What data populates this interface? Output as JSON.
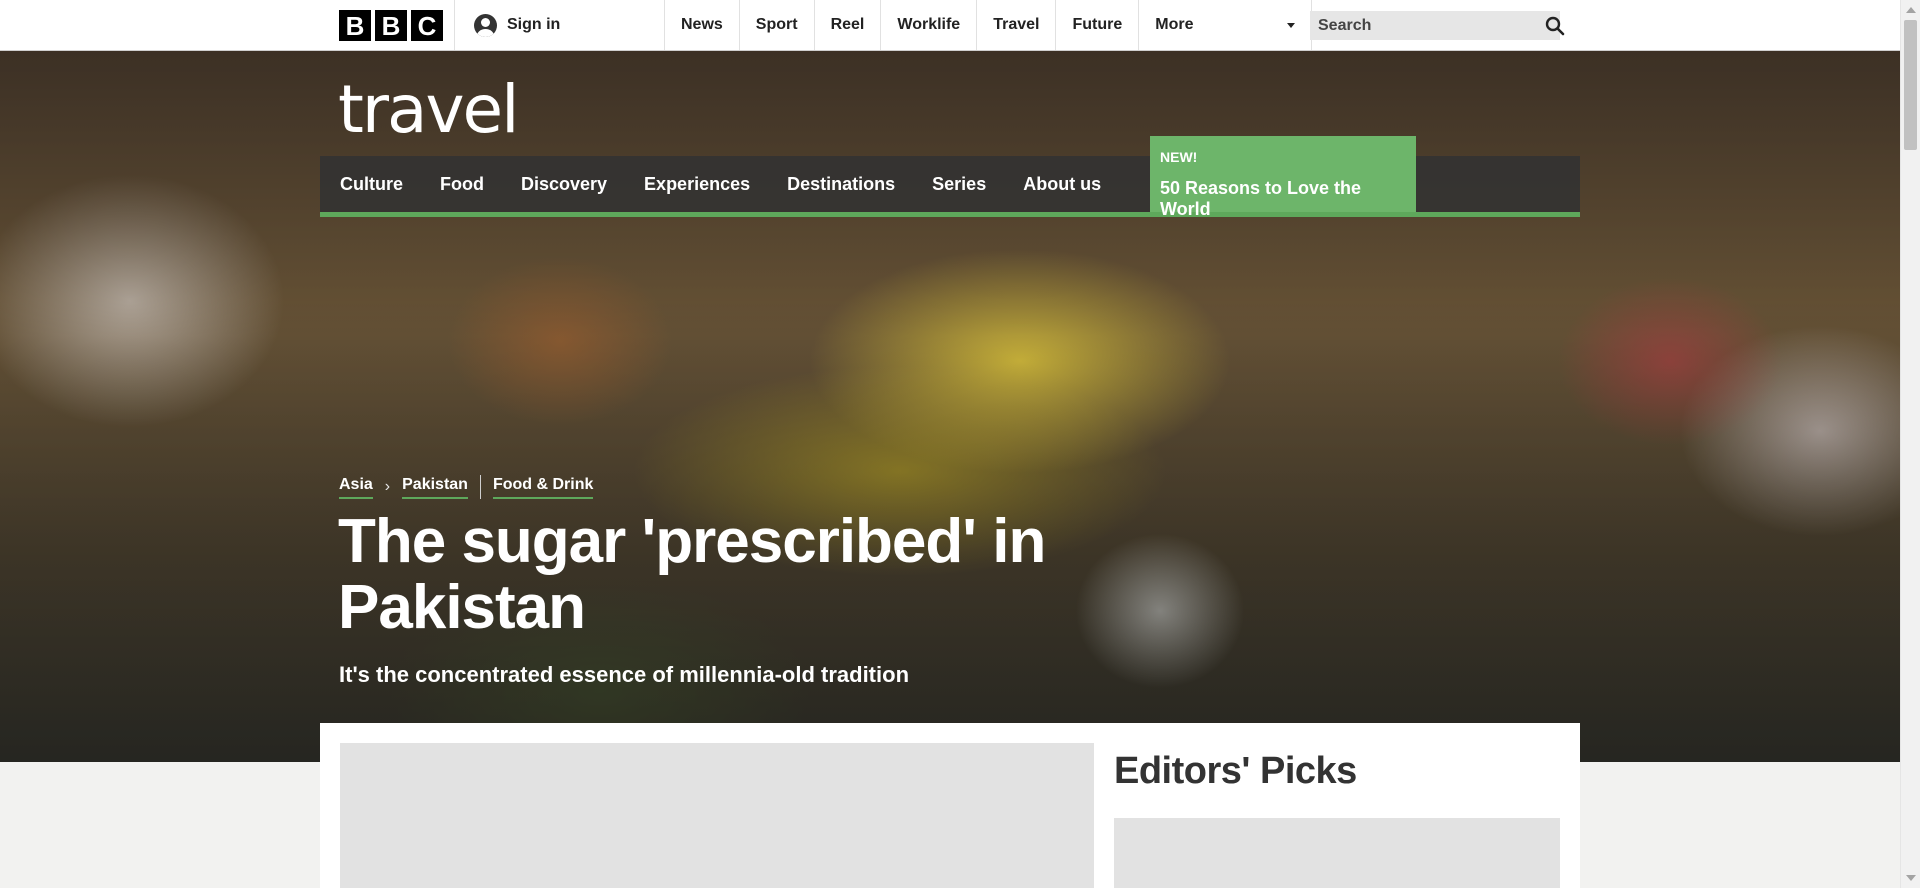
{
  "global_header": {
    "logo_letters": [
      "B",
      "B",
      "C"
    ],
    "sign_in_label": "Sign in",
    "nav": [
      "News",
      "Sport",
      "Reel",
      "Worklife",
      "Travel",
      "Future"
    ],
    "more_label": "More",
    "search_placeholder": "Search",
    "icons": {
      "account": "user-avatar-icon",
      "more": "caret-down-icon",
      "search": "magnifier-icon"
    }
  },
  "travel": {
    "logo_text": "travel",
    "section_nav": [
      "Culture",
      "Food",
      "Discovery",
      "Experiences",
      "Destinations",
      "Series",
      "About us"
    ],
    "promo": {
      "badge": "NEW!",
      "title": "50 Reasons to Love the World"
    },
    "accent_color": "#5ea85b"
  },
  "article": {
    "breadcrumbs": {
      "region": "Asia",
      "country": "Pakistan",
      "topic": "Food & Drink"
    },
    "headline": "The sugar 'prescribed' in Pakistan",
    "standfirst": "It's the concentrated essence of millennia-old tradition"
  },
  "sidebar": {
    "editors_picks_title": "Editors' Picks"
  }
}
